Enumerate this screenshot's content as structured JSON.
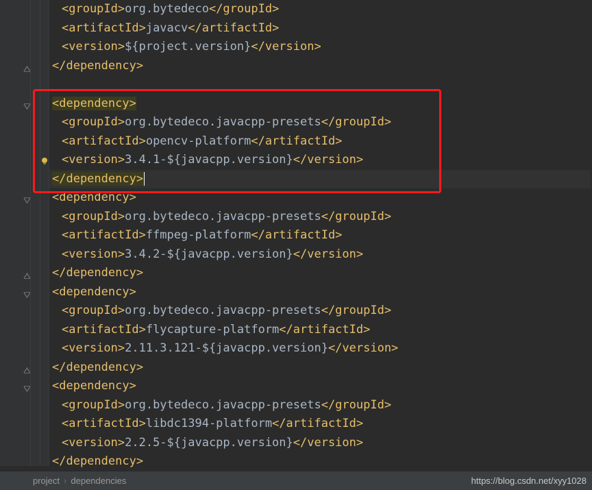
{
  "lines": [
    {
      "indent": 2,
      "parts": [
        [
          "tag",
          "<groupId>"
        ],
        [
          "txt",
          "org.bytedeco"
        ],
        [
          "tag",
          "</groupId>"
        ]
      ]
    },
    {
      "indent": 2,
      "parts": [
        [
          "tag",
          "<artifactId>"
        ],
        [
          "txt",
          "javacv"
        ],
        [
          "tag",
          "</artifactId>"
        ]
      ]
    },
    {
      "indent": 2,
      "parts": [
        [
          "tag",
          "<version>"
        ],
        [
          "txt",
          "${project.version}"
        ],
        [
          "tag",
          "</version>"
        ]
      ]
    },
    {
      "indent": 1,
      "parts": [
        [
          "tag",
          "</dependency>"
        ]
      ],
      "foldEnd": true
    },
    {
      "indent": 1,
      "parts": []
    },
    {
      "indent": 1,
      "parts": [
        [
          "hl",
          "<dependency>"
        ]
      ],
      "foldOpen": true
    },
    {
      "indent": 2,
      "parts": [
        [
          "tag",
          "<groupId>"
        ],
        [
          "txt",
          "org.bytedeco.javacpp-presets"
        ],
        [
          "tag",
          "</groupId>"
        ]
      ]
    },
    {
      "indent": 2,
      "parts": [
        [
          "tag",
          "<artifactId>"
        ],
        [
          "txt",
          "opencv-platform"
        ],
        [
          "tag",
          "</artifactId>"
        ]
      ]
    },
    {
      "indent": 2,
      "parts": [
        [
          "tag",
          "<version>"
        ],
        [
          "txt",
          "3.4.1-${javacpp.version}"
        ],
        [
          "tag",
          "</version>"
        ]
      ],
      "bulb": true
    },
    {
      "indent": 1,
      "parts": [
        [
          "hl",
          "</dependency>"
        ]
      ],
      "caret": true,
      "caretLine": true
    },
    {
      "indent": 1,
      "parts": [
        [
          "tag",
          "<dependency>"
        ]
      ],
      "foldOpen": true
    },
    {
      "indent": 2,
      "parts": [
        [
          "tag",
          "<groupId>"
        ],
        [
          "txt",
          "org.bytedeco.javacpp-presets"
        ],
        [
          "tag",
          "</groupId>"
        ]
      ]
    },
    {
      "indent": 2,
      "parts": [
        [
          "tag",
          "<artifactId>"
        ],
        [
          "txt",
          "ffmpeg-platform"
        ],
        [
          "tag",
          "</artifactId>"
        ]
      ]
    },
    {
      "indent": 2,
      "parts": [
        [
          "tag",
          "<version>"
        ],
        [
          "txt",
          "3.4.2-${javacpp.version}"
        ],
        [
          "tag",
          "</version>"
        ]
      ]
    },
    {
      "indent": 1,
      "parts": [
        [
          "tag",
          "</dependency>"
        ]
      ],
      "foldEnd": true
    },
    {
      "indent": 1,
      "parts": [
        [
          "tag",
          "<dependency>"
        ]
      ],
      "foldOpen": true
    },
    {
      "indent": 2,
      "parts": [
        [
          "tag",
          "<groupId>"
        ],
        [
          "txt",
          "org.bytedeco.javacpp-presets"
        ],
        [
          "tag",
          "</groupId>"
        ]
      ]
    },
    {
      "indent": 2,
      "parts": [
        [
          "tag",
          "<artifactId>"
        ],
        [
          "txt",
          "flycapture-platform"
        ],
        [
          "tag",
          "</artifactId>"
        ]
      ]
    },
    {
      "indent": 2,
      "parts": [
        [
          "tag",
          "<version>"
        ],
        [
          "txt",
          "2.11.3.121-${javacpp.version}"
        ],
        [
          "tag",
          "</version>"
        ]
      ]
    },
    {
      "indent": 1,
      "parts": [
        [
          "tag",
          "</dependency>"
        ]
      ],
      "foldEnd": true
    },
    {
      "indent": 1,
      "parts": [
        [
          "tag",
          "<dependency>"
        ]
      ],
      "foldOpen": true
    },
    {
      "indent": 2,
      "parts": [
        [
          "tag",
          "<groupId>"
        ],
        [
          "txt",
          "org.bytedeco.javacpp-presets"
        ],
        [
          "tag",
          "</groupId>"
        ]
      ]
    },
    {
      "indent": 2,
      "parts": [
        [
          "tag",
          "<artifactId>"
        ],
        [
          "txt",
          "libdc1394-platform"
        ],
        [
          "tag",
          "</artifactId>"
        ]
      ]
    },
    {
      "indent": 2,
      "parts": [
        [
          "tag",
          "<version>"
        ],
        [
          "txt",
          "2.2.5-${javacpp.version}"
        ],
        [
          "tag",
          "</version>"
        ]
      ]
    },
    {
      "indent": 1,
      "parts": [
        [
          "tag",
          "</dependency>"
        ]
      ]
    }
  ],
  "breadcrumbs": [
    "project",
    "dependencies"
  ],
  "watermark": "https://blog.csdn.net/xyy1028"
}
